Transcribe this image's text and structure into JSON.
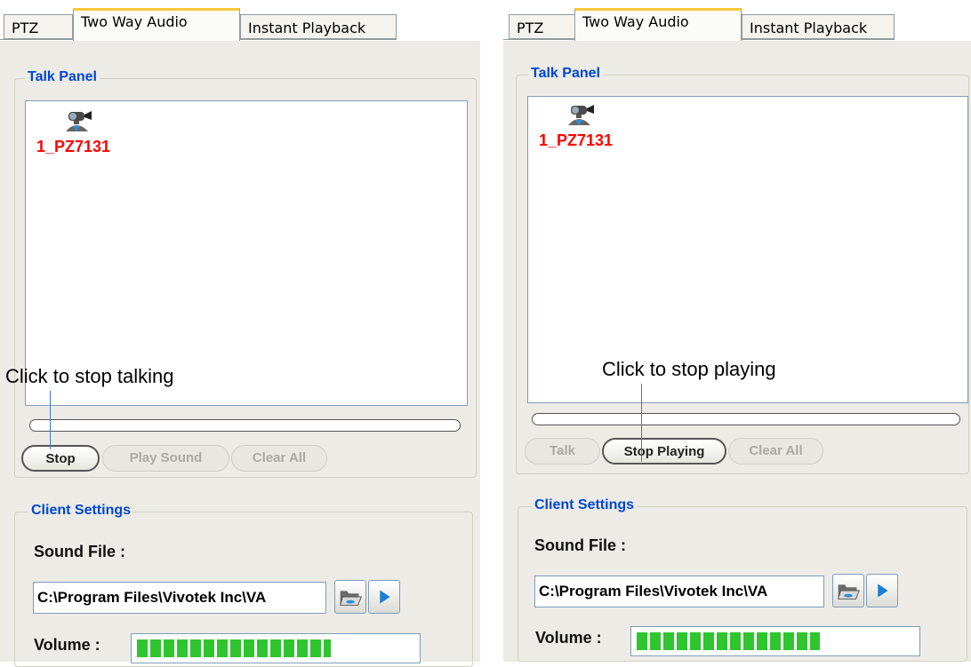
{
  "left": {
    "tabs": [
      "PTZ",
      "Two Way Audio",
      "Instant Playback"
    ],
    "talk_panel_title": "Talk Panel",
    "camera_name": "1_PZ7131",
    "buttons": [
      "Stop",
      "Play Sound",
      "Clear All"
    ],
    "client_settings_title": "Client Settings",
    "sound_file_label": "Sound File :",
    "sound_file_path": "C:\\Program Files\\Vivotek Inc\\VA",
    "volume_label": "Volume :",
    "volume_level": 0.7,
    "annotation": "Click to stop talking"
  },
  "right": {
    "tabs": [
      "PTZ",
      "Two Way Audio",
      "Instant Playback"
    ],
    "talk_panel_title": "Talk Panel",
    "camera_name": "1_PZ7131",
    "buttons": [
      "Talk",
      "Stop Playing",
      "Clear All"
    ],
    "client_settings_title": "Client Settings",
    "sound_file_label": "Sound File :",
    "sound_file_path": "C:\\Program Files\\Vivotek Inc\\VA",
    "volume_label": "Volume :",
    "volume_level": 0.66,
    "annotation": "Click to stop playing"
  },
  "icons": [
    "camera-icon",
    "folder-open-icon",
    "play-icon"
  ],
  "colors": {
    "legend": "#0046d5",
    "camera_label": "#ff0000",
    "active_tab_accent": "#ffc83c",
    "volume": "#2ec52e"
  }
}
